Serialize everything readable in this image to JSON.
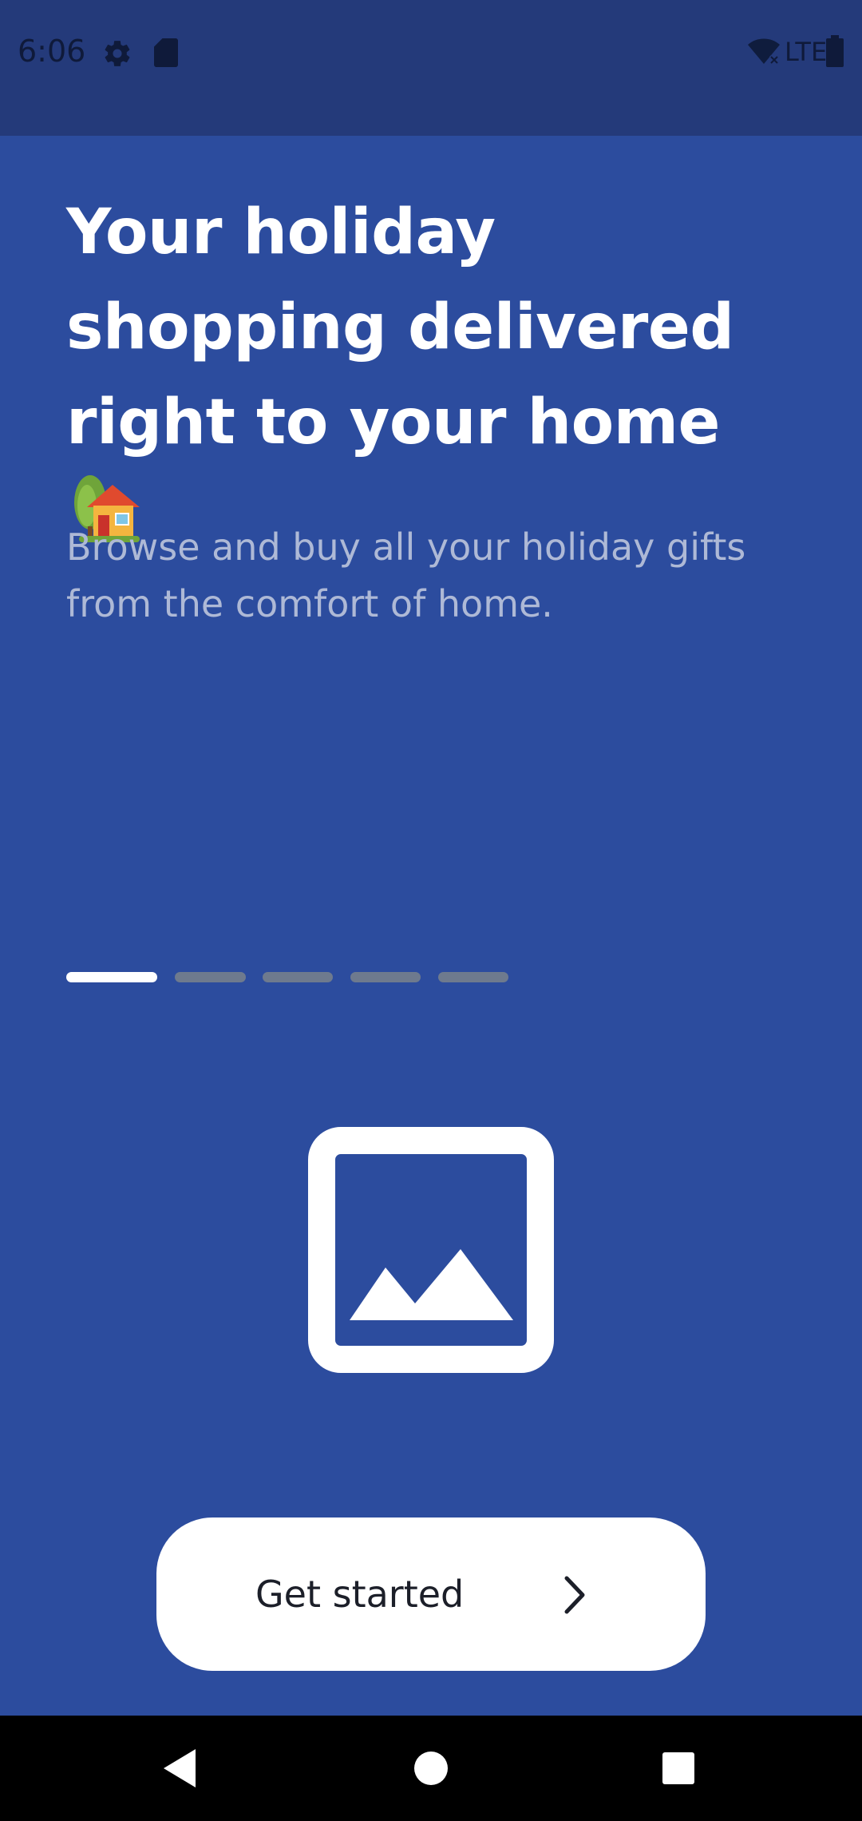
{
  "status_bar": {
    "time": "6:06",
    "network": "LTE",
    "icons": [
      "gear-icon",
      "sd-card-icon",
      "wifi-icon",
      "battery-icon"
    ]
  },
  "onboarding": {
    "headline": "Your holiday shopping delivered right to your home",
    "headline_emoji": "house-with-garden",
    "subtext": "Browse and buy all your holiday gifts from the comfort of home.",
    "page_indicator": {
      "total": 5,
      "current": 1
    },
    "image_icon": "image-placeholder-icon",
    "cta": {
      "label": "Get started",
      "icon": "chevron-right-icon"
    }
  },
  "colors": {
    "background": "#2c4c9e",
    "status_bar": "#243a7a",
    "headline": "#ffffff",
    "subtext": "#aeb9d6",
    "indicator_active": "#ffffff",
    "indicator_inactive": "#6e7a8e",
    "button_bg": "#ffffff",
    "button_text": "#1c1f29"
  },
  "nav_bar": {
    "buttons": [
      "back-icon",
      "home-icon",
      "recents-icon"
    ]
  }
}
